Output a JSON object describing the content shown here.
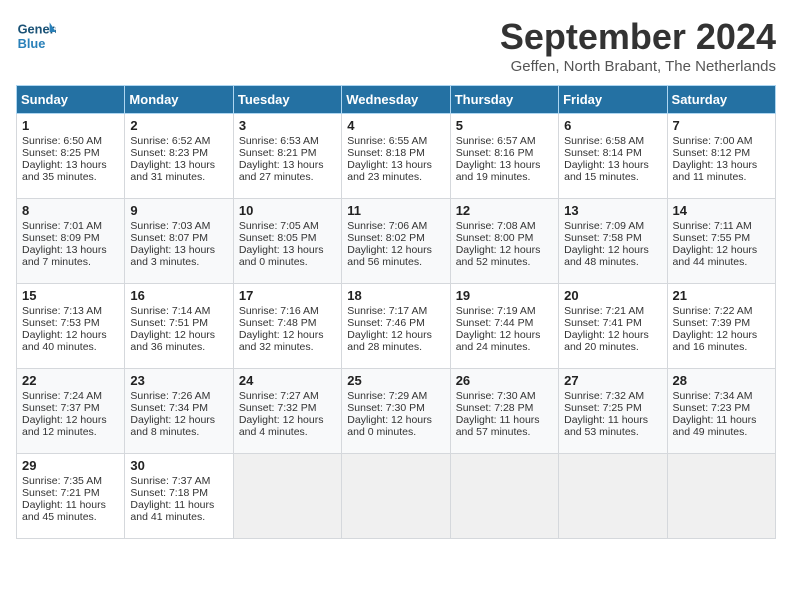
{
  "header": {
    "logo_line1": "General",
    "logo_line2": "Blue",
    "month": "September 2024",
    "location": "Geffen, North Brabant, The Netherlands"
  },
  "days_of_week": [
    "Sunday",
    "Monday",
    "Tuesday",
    "Wednesday",
    "Thursday",
    "Friday",
    "Saturday"
  ],
  "weeks": [
    [
      {
        "day": "1",
        "sunrise": "Sunrise: 6:50 AM",
        "sunset": "Sunset: 8:25 PM",
        "daylight": "Daylight: 13 hours and 35 minutes."
      },
      {
        "day": "2",
        "sunrise": "Sunrise: 6:52 AM",
        "sunset": "Sunset: 8:23 PM",
        "daylight": "Daylight: 13 hours and 31 minutes."
      },
      {
        "day": "3",
        "sunrise": "Sunrise: 6:53 AM",
        "sunset": "Sunset: 8:21 PM",
        "daylight": "Daylight: 13 hours and 27 minutes."
      },
      {
        "day": "4",
        "sunrise": "Sunrise: 6:55 AM",
        "sunset": "Sunset: 8:18 PM",
        "daylight": "Daylight: 13 hours and 23 minutes."
      },
      {
        "day": "5",
        "sunrise": "Sunrise: 6:57 AM",
        "sunset": "Sunset: 8:16 PM",
        "daylight": "Daylight: 13 hours and 19 minutes."
      },
      {
        "day": "6",
        "sunrise": "Sunrise: 6:58 AM",
        "sunset": "Sunset: 8:14 PM",
        "daylight": "Daylight: 13 hours and 15 minutes."
      },
      {
        "day": "7",
        "sunrise": "Sunrise: 7:00 AM",
        "sunset": "Sunset: 8:12 PM",
        "daylight": "Daylight: 13 hours and 11 minutes."
      }
    ],
    [
      {
        "day": "8",
        "sunrise": "Sunrise: 7:01 AM",
        "sunset": "Sunset: 8:09 PM",
        "daylight": "Daylight: 13 hours and 7 minutes."
      },
      {
        "day": "9",
        "sunrise": "Sunrise: 7:03 AM",
        "sunset": "Sunset: 8:07 PM",
        "daylight": "Daylight: 13 hours and 3 minutes."
      },
      {
        "day": "10",
        "sunrise": "Sunrise: 7:05 AM",
        "sunset": "Sunset: 8:05 PM",
        "daylight": "Daylight: 13 hours and 0 minutes."
      },
      {
        "day": "11",
        "sunrise": "Sunrise: 7:06 AM",
        "sunset": "Sunset: 8:02 PM",
        "daylight": "Daylight: 12 hours and 56 minutes."
      },
      {
        "day": "12",
        "sunrise": "Sunrise: 7:08 AM",
        "sunset": "Sunset: 8:00 PM",
        "daylight": "Daylight: 12 hours and 52 minutes."
      },
      {
        "day": "13",
        "sunrise": "Sunrise: 7:09 AM",
        "sunset": "Sunset: 7:58 PM",
        "daylight": "Daylight: 12 hours and 48 minutes."
      },
      {
        "day": "14",
        "sunrise": "Sunrise: 7:11 AM",
        "sunset": "Sunset: 7:55 PM",
        "daylight": "Daylight: 12 hours and 44 minutes."
      }
    ],
    [
      {
        "day": "15",
        "sunrise": "Sunrise: 7:13 AM",
        "sunset": "Sunset: 7:53 PM",
        "daylight": "Daylight: 12 hours and 40 minutes."
      },
      {
        "day": "16",
        "sunrise": "Sunrise: 7:14 AM",
        "sunset": "Sunset: 7:51 PM",
        "daylight": "Daylight: 12 hours and 36 minutes."
      },
      {
        "day": "17",
        "sunrise": "Sunrise: 7:16 AM",
        "sunset": "Sunset: 7:48 PM",
        "daylight": "Daylight: 12 hours and 32 minutes."
      },
      {
        "day": "18",
        "sunrise": "Sunrise: 7:17 AM",
        "sunset": "Sunset: 7:46 PM",
        "daylight": "Daylight: 12 hours and 28 minutes."
      },
      {
        "day": "19",
        "sunrise": "Sunrise: 7:19 AM",
        "sunset": "Sunset: 7:44 PM",
        "daylight": "Daylight: 12 hours and 24 minutes."
      },
      {
        "day": "20",
        "sunrise": "Sunrise: 7:21 AM",
        "sunset": "Sunset: 7:41 PM",
        "daylight": "Daylight: 12 hours and 20 minutes."
      },
      {
        "day": "21",
        "sunrise": "Sunrise: 7:22 AM",
        "sunset": "Sunset: 7:39 PM",
        "daylight": "Daylight: 12 hours and 16 minutes."
      }
    ],
    [
      {
        "day": "22",
        "sunrise": "Sunrise: 7:24 AM",
        "sunset": "Sunset: 7:37 PM",
        "daylight": "Daylight: 12 hours and 12 minutes."
      },
      {
        "day": "23",
        "sunrise": "Sunrise: 7:26 AM",
        "sunset": "Sunset: 7:34 PM",
        "daylight": "Daylight: 12 hours and 8 minutes."
      },
      {
        "day": "24",
        "sunrise": "Sunrise: 7:27 AM",
        "sunset": "Sunset: 7:32 PM",
        "daylight": "Daylight: 12 hours and 4 minutes."
      },
      {
        "day": "25",
        "sunrise": "Sunrise: 7:29 AM",
        "sunset": "Sunset: 7:30 PM",
        "daylight": "Daylight: 12 hours and 0 minutes."
      },
      {
        "day": "26",
        "sunrise": "Sunrise: 7:30 AM",
        "sunset": "Sunset: 7:28 PM",
        "daylight": "Daylight: 11 hours and 57 minutes."
      },
      {
        "day": "27",
        "sunrise": "Sunrise: 7:32 AM",
        "sunset": "Sunset: 7:25 PM",
        "daylight": "Daylight: 11 hours and 53 minutes."
      },
      {
        "day": "28",
        "sunrise": "Sunrise: 7:34 AM",
        "sunset": "Sunset: 7:23 PM",
        "daylight": "Daylight: 11 hours and 49 minutes."
      }
    ],
    [
      {
        "day": "29",
        "sunrise": "Sunrise: 7:35 AM",
        "sunset": "Sunset: 7:21 PM",
        "daylight": "Daylight: 11 hours and 45 minutes."
      },
      {
        "day": "30",
        "sunrise": "Sunrise: 7:37 AM",
        "sunset": "Sunset: 7:18 PM",
        "daylight": "Daylight: 11 hours and 41 minutes."
      },
      {
        "day": "",
        "sunrise": "",
        "sunset": "",
        "daylight": ""
      },
      {
        "day": "",
        "sunrise": "",
        "sunset": "",
        "daylight": ""
      },
      {
        "day": "",
        "sunrise": "",
        "sunset": "",
        "daylight": ""
      },
      {
        "day": "",
        "sunrise": "",
        "sunset": "",
        "daylight": ""
      },
      {
        "day": "",
        "sunrise": "",
        "sunset": "",
        "daylight": ""
      }
    ]
  ]
}
